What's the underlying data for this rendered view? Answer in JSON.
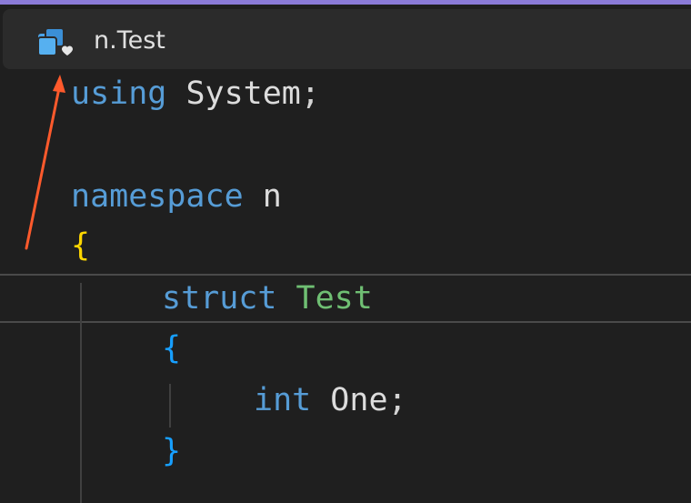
{
  "accent_color": "#8b7bd8",
  "navigation": {
    "scope_icon": "struct-scope-icon",
    "scope_label": "n.Test"
  },
  "code": {
    "line1": {
      "keyword": "using",
      "name": "System",
      "punct": ";"
    },
    "line3": {
      "keyword": "namespace",
      "name": "n"
    },
    "line4": {
      "brace": "{"
    },
    "line5": {
      "keyword": "struct",
      "name": "Test"
    },
    "line6": {
      "brace": "{"
    },
    "line7": {
      "keyword": "int",
      "name": "One",
      "punct": ";"
    },
    "line8": {
      "brace": "}"
    }
  },
  "annotation": {
    "arrow_color": "#ff5a2c",
    "arrow_icon": "annotation-arrow-icon"
  }
}
